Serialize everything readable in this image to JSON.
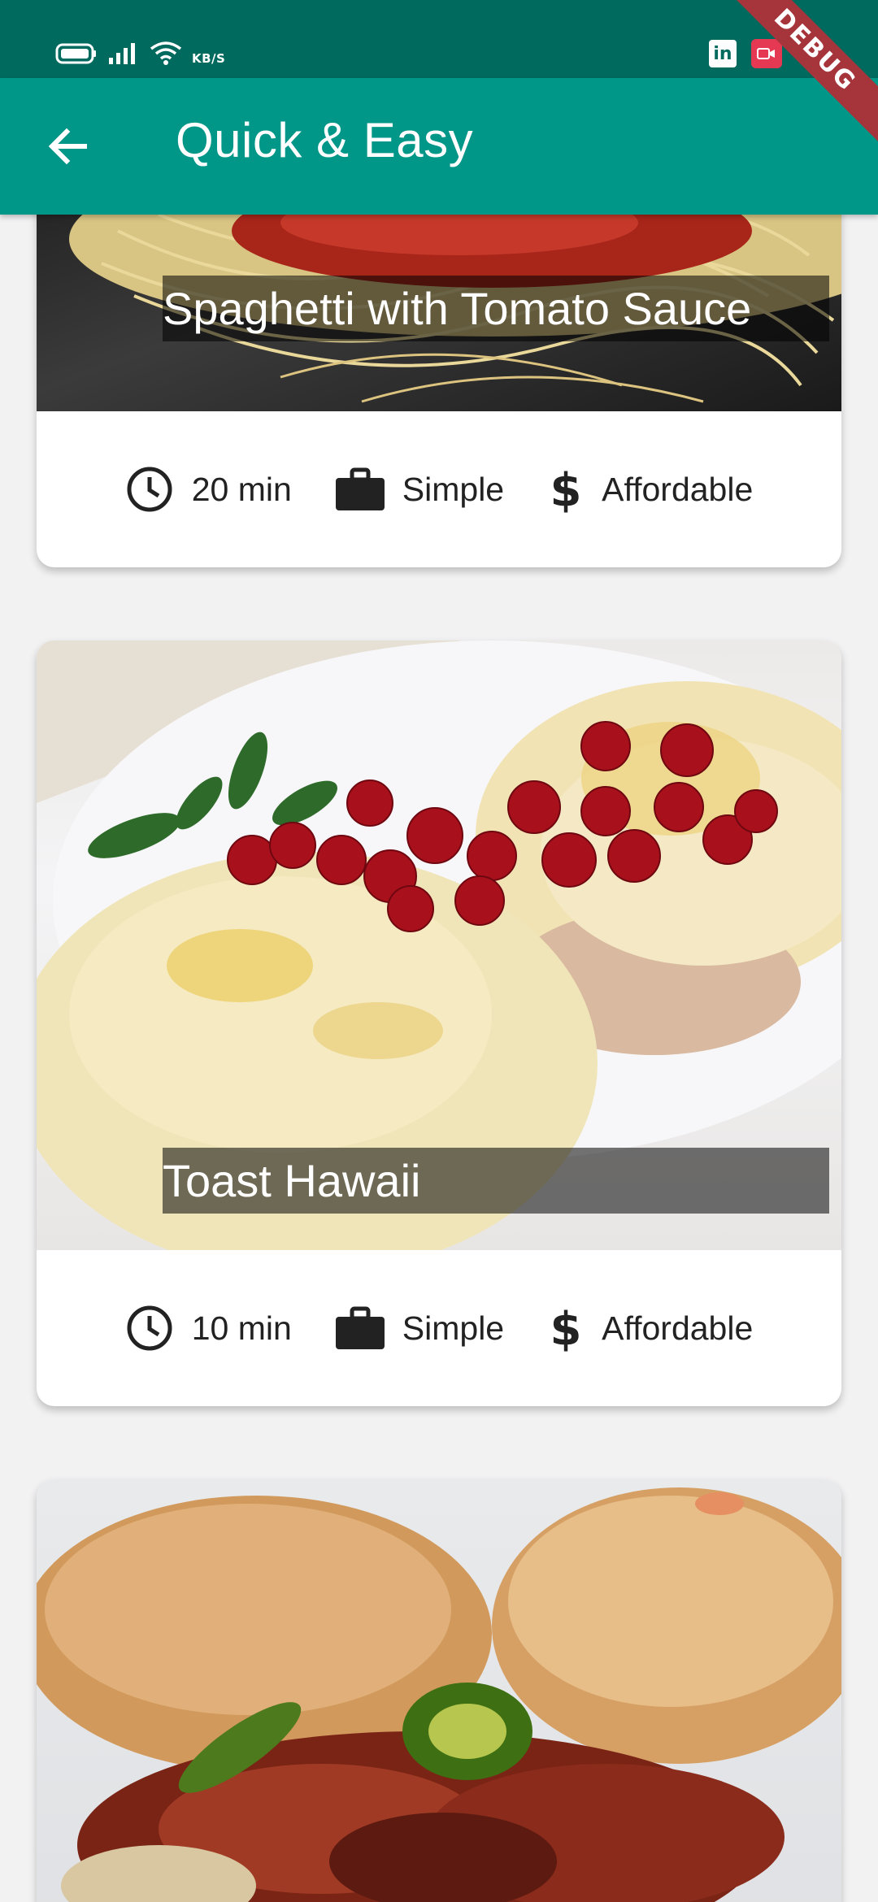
{
  "status_bar": {
    "net_speed_label": "KB/S",
    "linkedin_label": "in"
  },
  "debug_banner": "DEBUG",
  "app_bar": {
    "title": "Quick & Easy",
    "back_icon": "arrow-left-icon"
  },
  "meals": [
    {
      "title": "Spaghetti with Tomato Sauce",
      "duration": "20 min",
      "complexity": "Simple",
      "affordability": "Affordable"
    },
    {
      "title": "Toast Hawaii",
      "duration": "10 min",
      "complexity": "Simple",
      "affordability": "Affordable"
    },
    {
      "title": "",
      "duration": "",
      "complexity": "",
      "affordability": ""
    }
  ],
  "icons": {
    "duration": "clock-icon",
    "complexity": "briefcase-icon",
    "affordability": "dollar-icon"
  },
  "colors": {
    "app_bar": "#009688",
    "status_bar": "#006a5e",
    "background": "#f2f2f3",
    "card": "#ffffff"
  }
}
